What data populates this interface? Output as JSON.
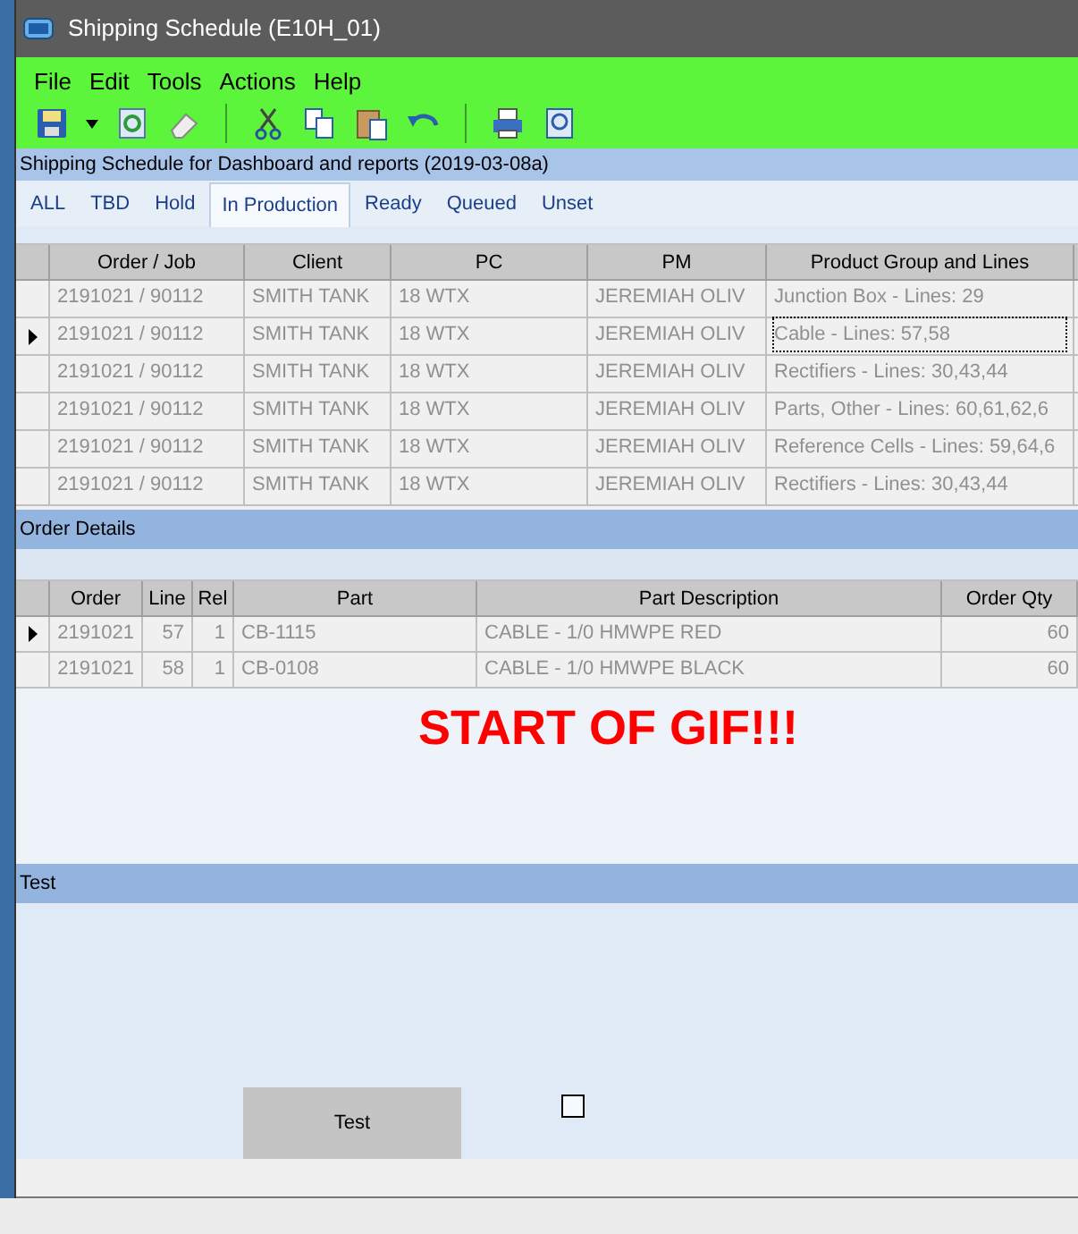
{
  "window": {
    "title": "Shipping Schedule (E10H_01)"
  },
  "menu": [
    "File",
    "Edit",
    "Tools",
    "Actions",
    "Help"
  ],
  "toolbar": [
    {
      "kind": "save"
    },
    {
      "kind": "dropdown"
    },
    {
      "kind": "refresh"
    },
    {
      "kind": "eraser"
    },
    {
      "kind": "sep"
    },
    {
      "kind": "cut"
    },
    {
      "kind": "copy"
    },
    {
      "kind": "paste"
    },
    {
      "kind": "undo"
    },
    {
      "kind": "sep"
    },
    {
      "kind": "print"
    },
    {
      "kind": "preview"
    }
  ],
  "subtitle": "Shipping Schedule for Dashboard and reports (2019-03-08a)",
  "tabs": [
    {
      "label": "ALL",
      "selected": false
    },
    {
      "label": "TBD",
      "selected": false
    },
    {
      "label": "Hold",
      "selected": false
    },
    {
      "label": "In Production",
      "selected": true
    },
    {
      "label": "Ready",
      "selected": false
    },
    {
      "label": "Queued",
      "selected": false
    },
    {
      "label": "Unset",
      "selected": false
    }
  ],
  "schedule_table": {
    "columns": [
      "Order / Job",
      "Client",
      "PC",
      "PM",
      "Product Group and Lines"
    ],
    "rows": [
      {
        "selected": false,
        "cells": [
          "2191021 / 90112",
          "SMITH TANK",
          "18 WTX",
          "JEREMIAH OLIV",
          "Junction Box - Lines: 29"
        ]
      },
      {
        "selected": true,
        "cells": [
          "2191021 / 90112",
          "SMITH TANK",
          "18 WTX",
          "JEREMIAH OLIV",
          "Cable - Lines: 57,58"
        ]
      },
      {
        "selected": false,
        "cells": [
          "2191021 / 90112",
          "SMITH TANK",
          "18 WTX",
          "JEREMIAH OLIV",
          "Rectifiers - Lines: 30,43,44"
        ]
      },
      {
        "selected": false,
        "cells": [
          "2191021 / 90112",
          "SMITH TANK",
          "18 WTX",
          "JEREMIAH OLIV",
          "Parts, Other - Lines: 60,61,62,6"
        ]
      },
      {
        "selected": false,
        "cells": [
          "2191021 / 90112",
          "SMITH TANK",
          "18 WTX",
          "JEREMIAH OLIV",
          "Reference Cells - Lines: 59,64,6"
        ]
      },
      {
        "selected": false,
        "cells": [
          "2191021 / 90112",
          "SMITH TANK",
          "18 WTX",
          "JEREMIAH OLIV",
          "Rectifiers - Lines: 30,43,44"
        ]
      }
    ]
  },
  "order_details": {
    "title": "Order Details",
    "columns": [
      "Order",
      "Line",
      "Rel",
      "Part",
      "Part Description",
      "Order Qty"
    ],
    "rows": [
      {
        "selected": true,
        "cells": [
          "2191021",
          "57",
          "1",
          "CB-1115",
          "CABLE - 1/0 HMWPE RED",
          "60"
        ]
      },
      {
        "selected": false,
        "cells": [
          "2191021",
          "58",
          "1",
          "CB-0108",
          "CABLE - 1/0 HMWPE BLACK",
          "60"
        ]
      }
    ]
  },
  "overlay": "START OF GIF!!!",
  "test_panel": {
    "title": "Test",
    "button": "Test",
    "checked": false
  }
}
